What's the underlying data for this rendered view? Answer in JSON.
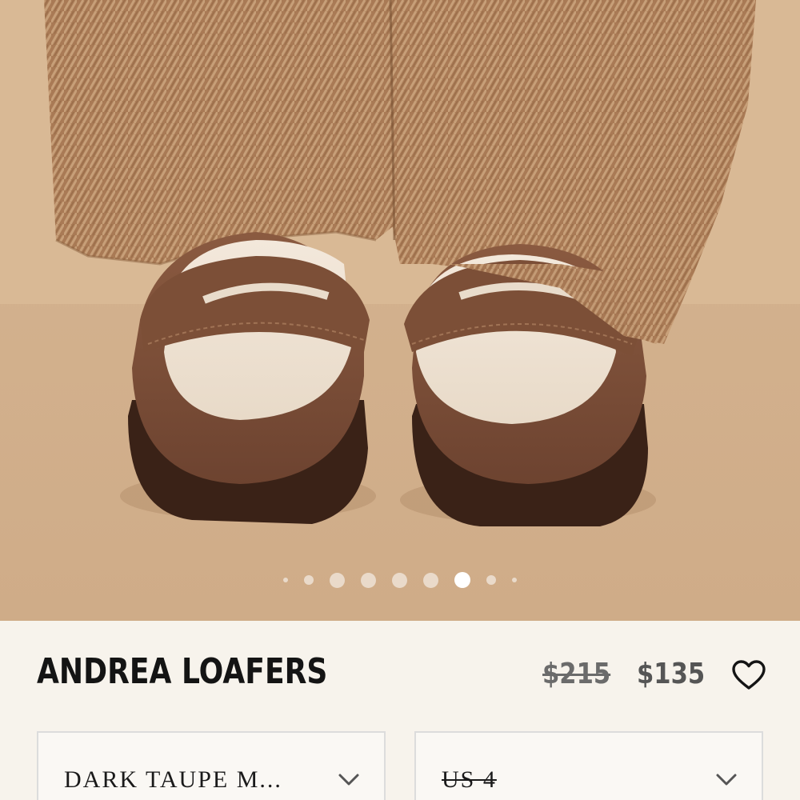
{
  "product": {
    "title": "ANDREA LOAFERS",
    "price_original": "$215",
    "price_sale": "$135",
    "wishlist_icon": "heart-icon"
  },
  "gallery": {
    "total_images": 9,
    "active_index": 6,
    "dot_icon": "carousel-dot"
  },
  "selectors": {
    "color": {
      "value": "DARK TAUPE M...",
      "icon": "chevron-down-icon"
    },
    "size": {
      "value": "US 4",
      "icon": "chevron-down-icon",
      "unavailable": true
    }
  },
  "colors": {
    "page_background": "#f7f3ec",
    "text_primary": "#141414",
    "price_text": "#555555",
    "select_border": "#dcdcdc"
  }
}
